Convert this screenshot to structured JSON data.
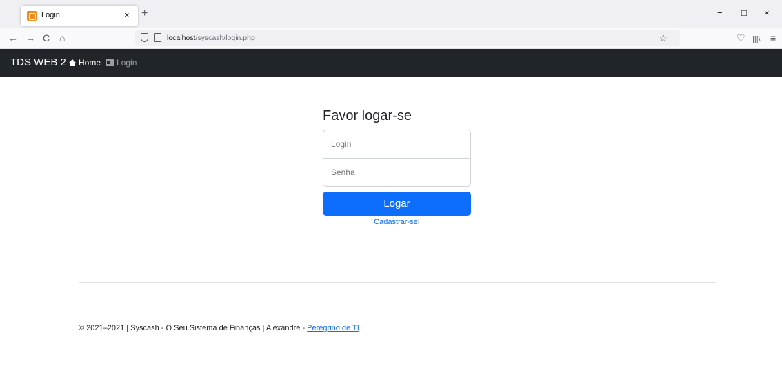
{
  "browser": {
    "tab_title": "Login",
    "tab_close": "×",
    "new_tab": "+",
    "url_host": "localhost",
    "url_path": "/syscash/login.php",
    "window": {
      "minimize": "−",
      "maximize": "□",
      "close": "×"
    },
    "nav": {
      "back": "←",
      "forward": "→",
      "reload": "C",
      "home": "⌂",
      "bookmark": "☆",
      "pocket": "♡",
      "library": "|||\\",
      "menu": "≡"
    }
  },
  "site_nav": {
    "brand": "TDS WEB 2",
    "home_label": "Home",
    "login_label": "Login"
  },
  "form": {
    "title": "Favor logar-se",
    "login_placeholder": "Login",
    "senha_placeholder": "Senha",
    "submit_label": "Logar",
    "register_link": "Cadastrar-se!"
  },
  "footer": {
    "text": "© 2021–2021 | Syscash - O Seu Sistema de Finanças | Alexandre - ",
    "link": "Peregrino de TI"
  }
}
